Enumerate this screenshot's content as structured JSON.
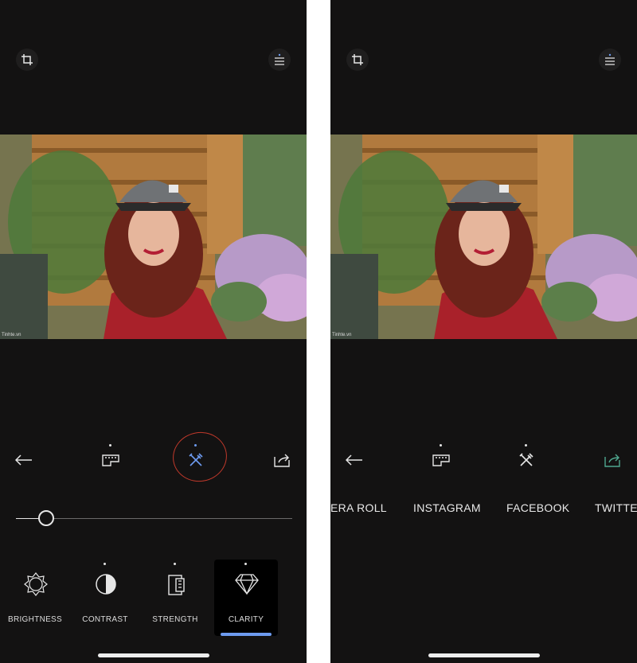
{
  "left_screen": {
    "adjustments": [
      {
        "label": "BRIGHTNESS",
        "icon": "sun-outline-icon"
      },
      {
        "label": "CONTRAST",
        "icon": "half-circle-icon"
      },
      {
        "label": "STRENGTH",
        "icon": "film-icon"
      },
      {
        "label": "CLARITY",
        "icon": "diamond-icon",
        "selected": true
      }
    ],
    "slider_value": 0.11,
    "annotation_color": "#c0392b",
    "accent": "#6d9bf0"
  },
  "right_screen": {
    "share_targets": [
      "ERA ROLL",
      "INSTAGRAM",
      "FACEBOOK",
      "TWITTE"
    ]
  },
  "photo": {
    "watermark": "Tinhte.vn"
  }
}
